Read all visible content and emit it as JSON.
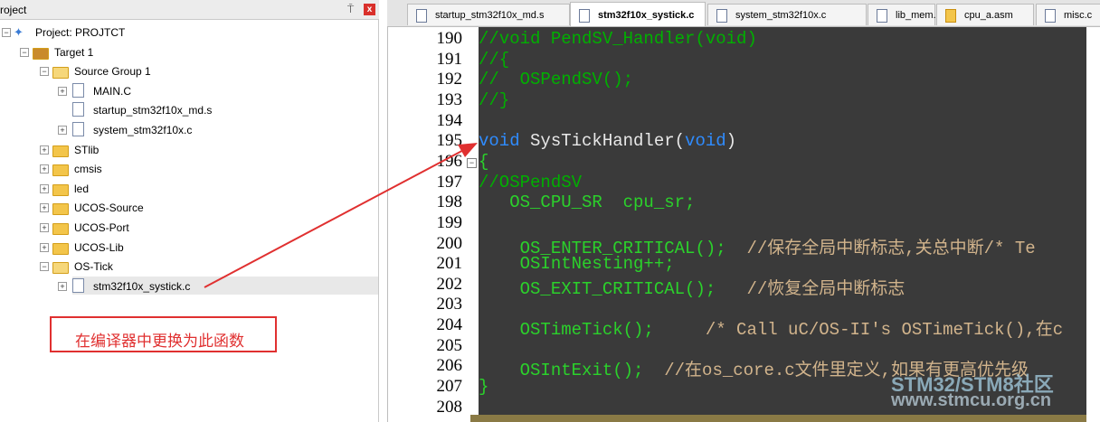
{
  "project_panel": {
    "title": "roject",
    "pin_glyph": "⍑",
    "close_glyph": "x",
    "tree": [
      {
        "label": "Project: PROJTCT",
        "type": "project",
        "expander": "-"
      },
      {
        "label": "Target 1",
        "type": "target",
        "expander": "-"
      },
      {
        "label": "Source Group 1",
        "type": "folder-open",
        "expander": "-"
      },
      {
        "label": "MAIN.C",
        "type": "file",
        "expander": "+"
      },
      {
        "label": "startup_stm32f10x_md.s",
        "type": "file",
        "expander": ""
      },
      {
        "label": "system_stm32f10x.c",
        "type": "file",
        "expander": "+"
      },
      {
        "label": "STlib",
        "type": "folder",
        "expander": "+"
      },
      {
        "label": "cmsis",
        "type": "folder",
        "expander": "+"
      },
      {
        "label": "led",
        "type": "folder",
        "expander": "+"
      },
      {
        "label": "UCOS-Source",
        "type": "folder",
        "expander": "+"
      },
      {
        "label": "UCOS-Port",
        "type": "folder",
        "expander": "+"
      },
      {
        "label": "UCOS-Lib",
        "type": "folder",
        "expander": "+"
      },
      {
        "label": "OS-Tick",
        "type": "folder-open",
        "expander": "-"
      },
      {
        "label": "stm32f10x_systick.c",
        "type": "file",
        "expander": "+"
      }
    ]
  },
  "annotation": {
    "callout_text": "在编译器中更换为此函数",
    "color": "#e03030"
  },
  "editor": {
    "tabs": [
      {
        "label": "startup_stm32f10x_md.s",
        "active": false
      },
      {
        "label": "stm32f10x_systick.c",
        "active": true
      },
      {
        "label": "system_stm32f10x.c",
        "active": false
      },
      {
        "label": "lib_mem.c",
        "active": false
      },
      {
        "label": "cpu_a.asm",
        "active": false
      },
      {
        "label": "misc.c",
        "active": false
      }
    ],
    "lines": [
      {
        "num": "190",
        "code": "//void PendSV_Handler(void)"
      },
      {
        "num": "191",
        "code": "//{"
      },
      {
        "num": "192",
        "code": "//  OSPendSV();"
      },
      {
        "num": "193",
        "code": "//}"
      },
      {
        "num": "194",
        "code": ""
      },
      {
        "num": "195",
        "kw1": "void",
        "fn": " SysTickHandler(",
        "kw2": "void",
        "end": ")"
      },
      {
        "num": "196",
        "code": "{"
      },
      {
        "num": "197",
        "code": "//OSPendSV"
      },
      {
        "num": "198",
        "code": "   OS_CPU_SR  cpu_sr;"
      },
      {
        "num": "199",
        "code": ""
      },
      {
        "num": "200",
        "code": "    OS_ENTER_CRITICAL();  ",
        "comment": "//保存全局中断标志,关总中断/* Te"
      },
      {
        "num": "201",
        "code": "    OSIntNesting++;"
      },
      {
        "num": "202",
        "code": "    OS_EXIT_CRITICAL();   ",
        "comment": "//恢复全局中断标志"
      },
      {
        "num": "203",
        "code": ""
      },
      {
        "num": "204",
        "code": "    OSTimeTick();     ",
        "comment": "/* Call uC/OS-II's OSTimeTick(),在c"
      },
      {
        "num": "205",
        "code": ""
      },
      {
        "num": "206",
        "code": "    OSIntExit();  ",
        "comment": "//在os_core.c文件里定义,如果有更高优先级"
      },
      {
        "num": "207",
        "code": "}"
      },
      {
        "num": "208",
        "code": ""
      }
    ]
  },
  "watermark": {
    "line1": "STM32/STM8社区",
    "line2": "www.stmcu.org.cn"
  },
  "colors": {
    "code_bg": "#3a3a3a",
    "comment": "#00b000",
    "keyword": "#2f8cff",
    "arrow": "#e03030"
  }
}
